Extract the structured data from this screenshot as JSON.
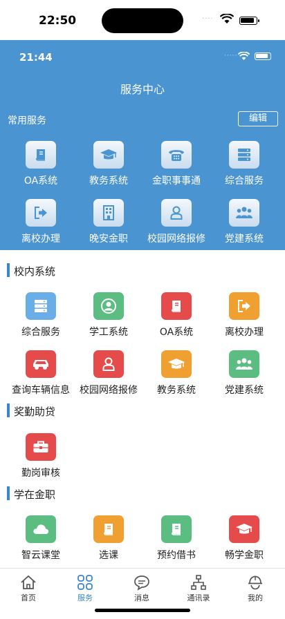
{
  "status": {
    "time": "22:50",
    "dots": "····"
  },
  "panel": {
    "inner_time": "21:44",
    "inner_dots": "·····",
    "title": "服务中心",
    "common_label": "常用服务",
    "edit_label": "编辑",
    "items": [
      {
        "label": "OA系统",
        "icon": "book-icon"
      },
      {
        "label": "教务系统",
        "icon": "graduation-cap-icon"
      },
      {
        "label": "金职事事通",
        "icon": "telephone-icon"
      },
      {
        "label": "综合服务",
        "icon": "server-icon"
      },
      {
        "label": "离校办理",
        "icon": "exit-arrow-icon"
      },
      {
        "label": "晚安金职",
        "icon": "building-icon"
      },
      {
        "label": "校园网络报修",
        "icon": "person-icon"
      },
      {
        "label": "党建系统",
        "icon": "group-icon"
      }
    ]
  },
  "sections": [
    {
      "title": "校内系统",
      "items": [
        {
          "label": "综合服务",
          "icon": "server-icon",
          "color": "#6aaee8"
        },
        {
          "label": "学工系统",
          "icon": "user-circle-icon",
          "color": "#5bbd82"
        },
        {
          "label": "OA系统",
          "icon": "book-icon",
          "color": "#e54b4b"
        },
        {
          "label": "离校办理",
          "icon": "exit-arrow-icon",
          "color": "#f0a030"
        },
        {
          "label": "查询车辆信息",
          "icon": "car-icon",
          "color": "#e54b4b"
        },
        {
          "label": "校园网络报修",
          "icon": "person-icon",
          "color": "#e54b4b"
        },
        {
          "label": "教务系统",
          "icon": "graduation-cap-icon",
          "color": "#f0a030"
        },
        {
          "label": "党建系统",
          "icon": "group-icon",
          "color": "#5bbd82"
        }
      ]
    },
    {
      "title": "奖勤助贷",
      "items": [
        {
          "label": "勤岗审核",
          "icon": "briefcase-icon",
          "color": "#e54b4b"
        }
      ]
    },
    {
      "title": "学在金职",
      "items": [
        {
          "label": "智云课堂",
          "icon": "cloud-icon",
          "color": "#5bbd82"
        },
        {
          "label": "选课",
          "icon": "book-icon",
          "color": "#f0a030"
        },
        {
          "label": "预约借书",
          "icon": "book-icon",
          "color": "#5bbd82"
        },
        {
          "label": "畅学金职",
          "icon": "graduation-cap-icon",
          "color": "#e54b4b"
        }
      ]
    }
  ],
  "tabs": [
    {
      "label": "首页",
      "icon": "home-icon",
      "active": false
    },
    {
      "label": "服务",
      "icon": "grid-icon",
      "active": true
    },
    {
      "label": "消息",
      "icon": "chat-bubble-icon",
      "active": false
    },
    {
      "label": "通讯录",
      "icon": "org-chart-icon",
      "active": false
    },
    {
      "label": "我的",
      "icon": "helmet-icon",
      "active": false
    }
  ],
  "colors": {
    "accent": "#3a86c8",
    "panel": "#4a94d2"
  }
}
